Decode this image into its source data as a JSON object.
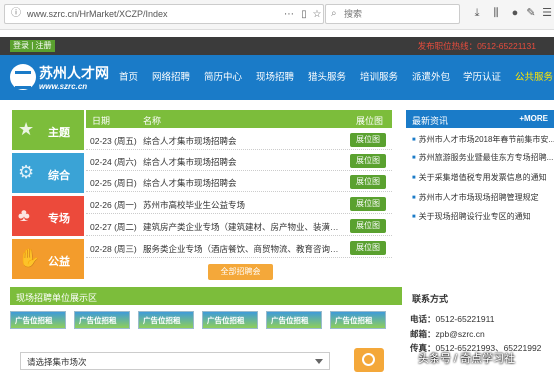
{
  "browser": {
    "url": "www.szrc.cn/HrMarket/XCZP/Index",
    "search_placeholder": "搜索"
  },
  "topbar": {
    "login": "登录",
    "separator": "|",
    "register": "注册",
    "phone": "发布职位热线：0512-65221131"
  },
  "logo": {
    "cn": "苏州人才网",
    "en": "www.szrc.cn"
  },
  "nav": [
    "首页",
    "网络招聘",
    "简历中心",
    "现场招聘",
    "猎头服务",
    "培训服务",
    "派遣外包",
    "学历认证",
    "公共服务"
  ],
  "categories": {
    "main": "主题",
    "comp": "综合",
    "prof": "专场",
    "pub": "公益"
  },
  "table": {
    "headers": {
      "date": "日期",
      "name": "名称",
      "map": "展位图"
    },
    "rows": [
      {
        "date": "02-23 (周五)",
        "name": "综合人才集市现场招聘会",
        "map": "展位图"
      },
      {
        "date": "02-24 (周六)",
        "name": "综合人才集市现场招聘会",
        "map": "展位图"
      },
      {
        "date": "02-25 (周日)",
        "name": "综合人才集市现场招聘会",
        "map": "展位图"
      },
      {
        "date": "02-26 (周一)",
        "name": "苏州市高校毕业生公益专场",
        "map": "展位图"
      },
      {
        "date": "02-27 (周二)",
        "name": "建筑房产类企业专场（建筑建材、房产物业、装潢设计...",
        "map": "展位图"
      },
      {
        "date": "02-28 (周三)",
        "name": "服务类企业专场（酒店餐饮、商贸物流、教育咨询、金...",
        "map": "展位图"
      }
    ],
    "all_button": "全部招聘会"
  },
  "news": {
    "title": "最新资讯",
    "more": "+MORE",
    "items": [
      "苏州市人才市场2018年春节前集市安...",
      "苏州旅游服务业暨最佳东方专场招聘...",
      "关于采集增值税专用发票信息的通知",
      "苏州市人才市场现场招聘管理规定",
      "关于现场招聘设行业专区的通知"
    ]
  },
  "venue": {
    "title": "现场招聘单位展示区",
    "ads": [
      "广告位招租",
      "广告位招租",
      "广告位招租",
      "广告位招租",
      "广告位招租",
      "广告位招租"
    ]
  },
  "market_select": {
    "value": "请选择集市场次"
  },
  "contact": {
    "title": "联系方式",
    "phone_label": "电话：",
    "phone": "0512-65221911",
    "email_label": "邮箱：",
    "email": "zpb@szrc.cn",
    "fax_label": "传真：",
    "fax": "0512-65221993、65221992"
  },
  "watermark": "头条号 / 奇点学习社"
}
